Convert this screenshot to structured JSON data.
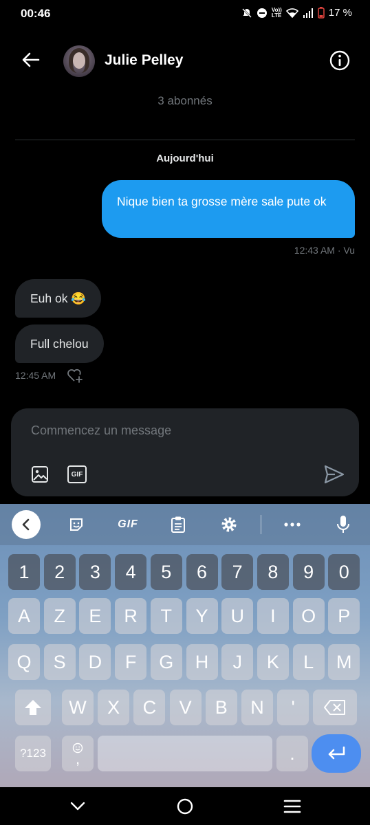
{
  "status_bar": {
    "time": "00:46",
    "battery": "17 %"
  },
  "header": {
    "contact_name": "Julie Pelley",
    "followers": "3 abonnés"
  },
  "conversation": {
    "date_label": "Aujourd'hui",
    "outgoing": {
      "text": "Nique bien ta grosse mère sale pute ok",
      "meta": "12:43 AM · Vu"
    },
    "incoming": [
      {
        "text": "Euh ok 😂"
      },
      {
        "text": "Full chelou"
      }
    ],
    "incoming_meta": "12:45 AM"
  },
  "composer": {
    "placeholder": "Commencez un message",
    "gif_label": "GIF"
  },
  "keyboard": {
    "toolbar_gif": "GIF",
    "row_numbers": [
      "1",
      "2",
      "3",
      "4",
      "5",
      "6",
      "7",
      "8",
      "9",
      "0"
    ],
    "row_1": [
      "A",
      "Z",
      "E",
      "R",
      "T",
      "Y",
      "U",
      "I",
      "O",
      "P"
    ],
    "row_2": [
      "Q",
      "S",
      "D",
      "F",
      "G",
      "H",
      "J",
      "K",
      "L",
      "M"
    ],
    "row_3": [
      "W",
      "X",
      "C",
      "V",
      "B",
      "N",
      "'"
    ],
    "symbols_key": "?123",
    "comma_key": ",",
    "period_key": "."
  },
  "colors": {
    "accent": "#1d9bf0",
    "enter_key": "#4d8ef0",
    "bubble_in": "#202327",
    "muted": "#71767b"
  },
  "icons": [
    "back-arrow-icon",
    "info-icon",
    "heart-plus-icon",
    "image-icon",
    "gif-icon",
    "send-icon",
    "chevron-left-icon",
    "sticker-icon",
    "clipboard-icon",
    "gear-icon",
    "more-icon",
    "mic-icon",
    "shift-icon",
    "backspace-icon",
    "emoji-icon",
    "enter-icon",
    "nav-back-icon",
    "nav-home-icon",
    "nav-recents-icon"
  ]
}
